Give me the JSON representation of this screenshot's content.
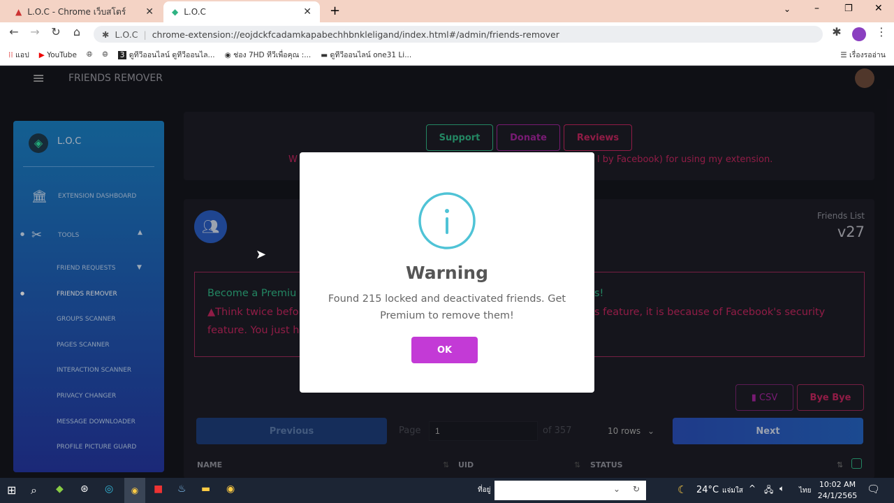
{
  "browser": {
    "tabs": [
      {
        "title": "L.O.C - Chrome เว็บสโตร์",
        "active": false
      },
      {
        "title": "L.O.C",
        "active": true
      }
    ],
    "site_label": "L.O.C",
    "url": "chrome-extension://eojdckfcadamkapabechhbnkleligand/index.html#/admin/friends-remover",
    "bookmarks": [
      "แอป",
      "YouTube",
      "",
      "",
      "ดูทีวีออนไลน์ ดูทีวีออนไล...",
      "ช่อง 7HD ทีวีเพื่อคุณ :...",
      "ดูทีวีออนไลน์ one31 Li..."
    ],
    "reading_list": "เรื่องรออ่าน"
  },
  "app": {
    "header_title": "FRIENDS REMOVER",
    "brand": "L.O.C",
    "sidebar": [
      {
        "label": "EXTENSION DASHBOARD",
        "icon": "bank-icon"
      },
      {
        "label": "TOOLS",
        "icon": "tools-icon"
      },
      {
        "label": "FRIEND REQUESTS"
      },
      {
        "label": "FRIENDS REMOVER",
        "active": true
      },
      {
        "label": "GROUPS SCANNER"
      },
      {
        "label": "PAGES SCANNER"
      },
      {
        "label": "INTERACTION SCANNER"
      },
      {
        "label": "PRIVACY CHANGER"
      },
      {
        "label": "MESSAGE DOWNLOADER"
      },
      {
        "label": "PROFILE PICTURE GUARD"
      }
    ],
    "top_buttons": {
      "support": "Support",
      "donate": "Donate",
      "reviews": "Reviews"
    },
    "warning_left": "W",
    "warning_right": "l by Facebook) for using my extension.",
    "friends_list_label": "Friends List",
    "version": "v27",
    "premium_text": "Become a Premiu",
    "premium_text_right": "s!",
    "think_text": "Think twice befo",
    "think_text_right": "s feature, it is because of Facebook's security",
    "feature_text": "feature. You just h",
    "csv": "CSV",
    "bye": "Bye Bye",
    "previous": "Previous",
    "page_label": "Page",
    "page_value": "1",
    "of_label": "of 357",
    "rows": "10 rows",
    "next": "Next",
    "columns": [
      "NAME",
      "UID",
      "STATUS"
    ]
  },
  "modal": {
    "icon": "info-icon",
    "title": "Warning",
    "message": "Found 215 locked and deactivated friends. Get Premium to remove them!",
    "ok": "OK"
  },
  "taskbar": {
    "address_label": "ที่อยู่",
    "weather": "24°C",
    "weather_text": "แจ่มใส",
    "lang": "ไทย",
    "time": "10:02 AM",
    "date": "24/1/2565"
  },
  "colors": {
    "support": "#2fb383",
    "donate": "#a0259a",
    "reviews": "#c2265e",
    "ok": "#c33ad6",
    "next": "#2a4fb8",
    "info": "#4fc3d6"
  }
}
